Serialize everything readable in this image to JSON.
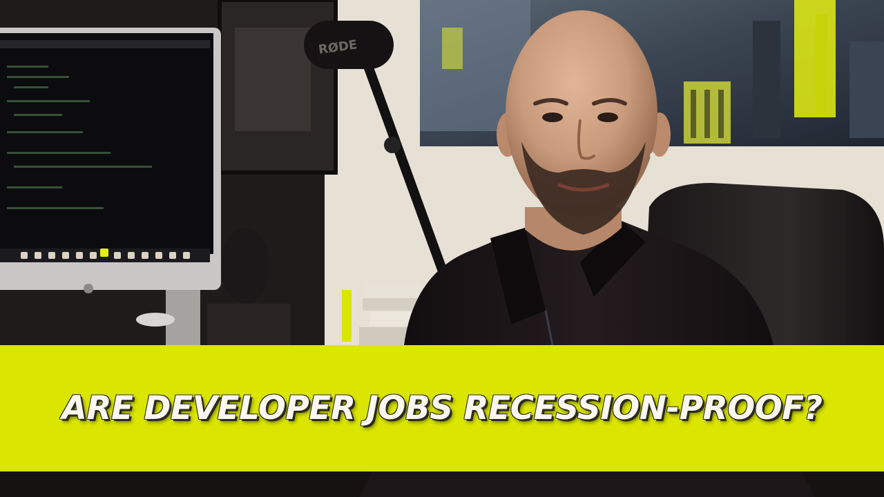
{
  "headline": "ARE DEVELOPER JOBS RECESSION-PROOF?",
  "monitor_brand_text": "RØDE",
  "colors": {
    "banner": "#dbe600",
    "headline_text": "#fbf7ef",
    "headline_shadow": "#2b2b1e",
    "wall": "#e7e1d5",
    "shirt": "#1a1416",
    "skin": "#c99b7c",
    "beard": "#3c2a22",
    "poster_accent": "#e4f012"
  },
  "icons": [
    "imac-monitor",
    "rode-microphone",
    "mic-boom-arm",
    "city-poster",
    "office-chair",
    "apple-logo",
    "keyboard",
    "books"
  ]
}
